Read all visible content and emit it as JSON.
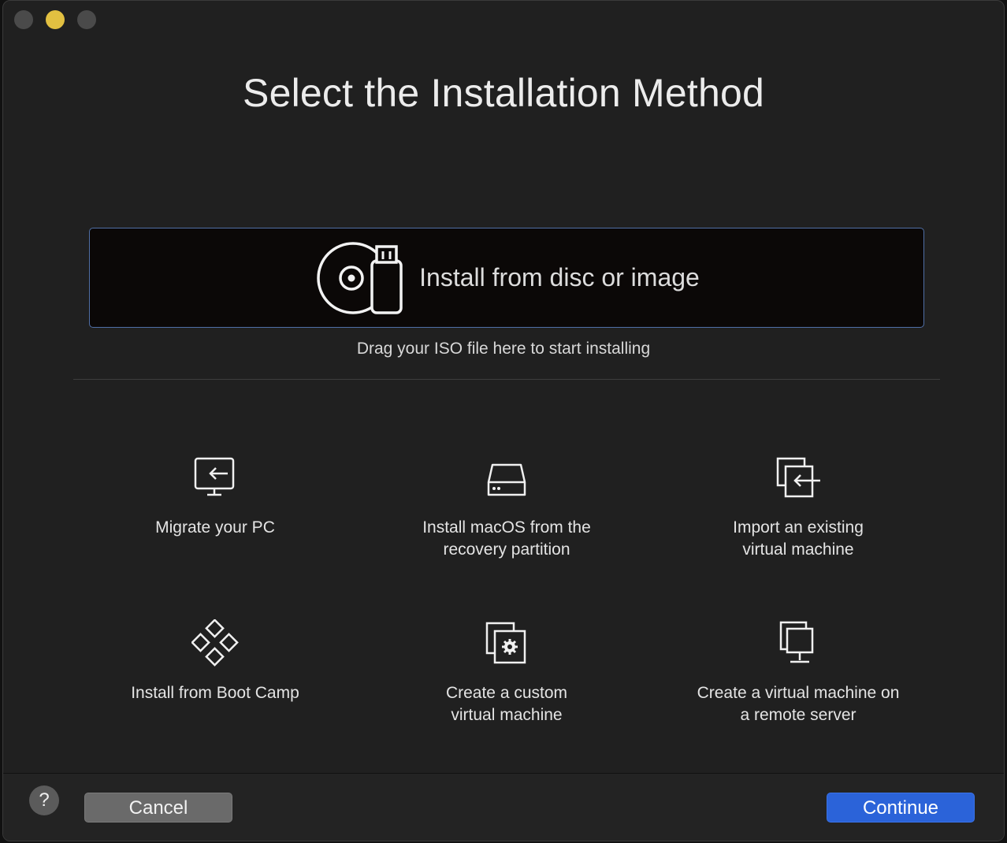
{
  "window": {
    "title": "Select the Installation Method",
    "traffic_lights": [
      "close",
      "minimize",
      "maximize"
    ]
  },
  "drop_zone": {
    "label": "Install from disc or image",
    "icon": "disc-usb-icon",
    "hint": "Drag your ISO file here to start installing"
  },
  "options": [
    {
      "label": "Migrate your PC",
      "icon": "migrate-pc-icon"
    },
    {
      "label": "Install macOS from the\nrecovery partition",
      "icon": "drive-icon"
    },
    {
      "label": "Import an existing\nvirtual machine",
      "icon": "import-vm-icon"
    },
    {
      "label": "Install from Boot Camp",
      "icon": "bootcamp-icon"
    },
    {
      "label": "Create a custom\nvirtual machine",
      "icon": "custom-vm-icon"
    },
    {
      "label": "Create a virtual machine on\na remote server",
      "icon": "remote-server-icon"
    }
  ],
  "footer": {
    "help_label": "?",
    "cancel_label": "Cancel",
    "continue_label": "Continue"
  },
  "colors": {
    "accent": "#2b63d9",
    "drop_border": "#4f6fa6",
    "background": "#202020"
  }
}
